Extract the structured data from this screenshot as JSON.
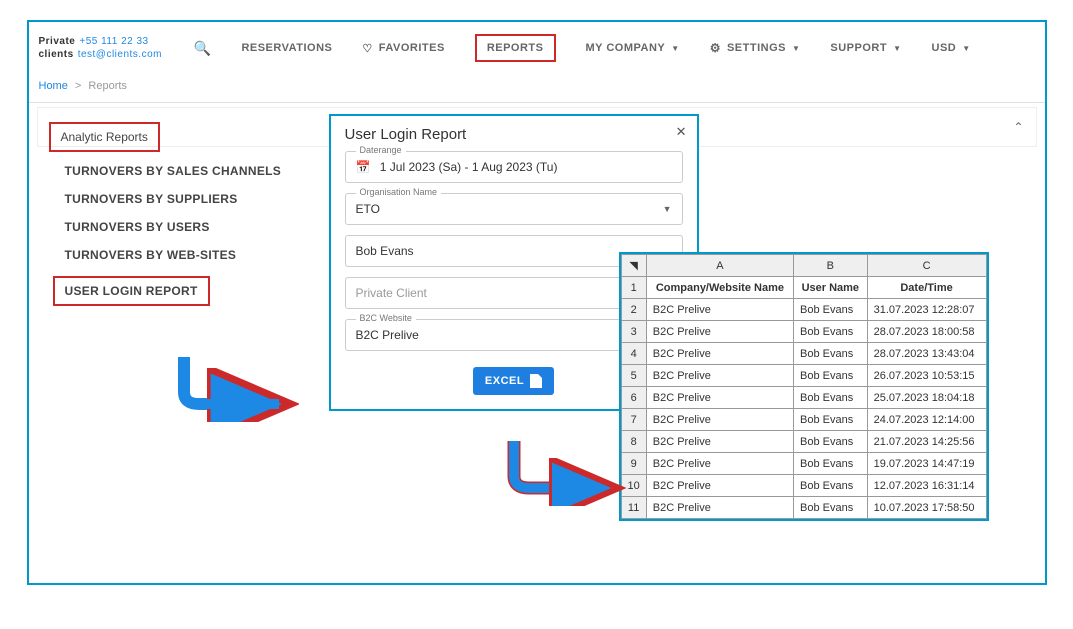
{
  "header": {
    "client_label1": "Private",
    "client_label2": "clients",
    "phone": "+55 111 22 33",
    "email": "test@clients.com",
    "nav": {
      "reservations": "RESERVATIONS",
      "favorites": "FAVORITES",
      "reports": "REPORTS",
      "my_company": "MY COMPANY",
      "settings": "SETTINGS",
      "support": "SUPPORT",
      "currency": "USD"
    }
  },
  "breadcrumb": {
    "home": "Home",
    "current": "Reports"
  },
  "sidebar": {
    "title": "Analytic Reports",
    "items": [
      "TURNOVERS BY SALES CHANNELS",
      "TURNOVERS BY SUPPLIERS",
      "TURNOVERS BY USERS",
      "TURNOVERS BY WEB-SITES",
      "USER LOGIN REPORT"
    ]
  },
  "form": {
    "title": "User Login Report",
    "daterange_label": "Daterange",
    "daterange_value": "1 Jul 2023 (Sa) - 1 Aug 2023 (Tu)",
    "org_label": "Organisation Name",
    "org_value": "ETO",
    "person_value": "Bob Evans",
    "client_placeholder": "Private Client",
    "website_label": "B2C Website",
    "website_value": "B2C Prelive",
    "excel_label": "EXCEL"
  },
  "sheet": {
    "cols": [
      "A",
      "B",
      "C"
    ],
    "headers": [
      "Company/Website Name",
      "User Name",
      "Date/Time"
    ],
    "rows": [
      [
        "B2C Prelive",
        "Bob Evans",
        "31.07.2023 12:28:07"
      ],
      [
        "B2C Prelive",
        "Bob Evans",
        "28.07.2023 18:00:58"
      ],
      [
        "B2C Prelive",
        "Bob Evans",
        "28.07.2023 13:43:04"
      ],
      [
        "B2C Prelive",
        "Bob Evans",
        "26.07.2023 10:53:15"
      ],
      [
        "B2C Prelive",
        "Bob Evans",
        "25.07.2023 18:04:18"
      ],
      [
        "B2C Prelive",
        "Bob Evans",
        "24.07.2023 12:14:00"
      ],
      [
        "B2C Prelive",
        "Bob Evans",
        "21.07.2023 14:25:56"
      ],
      [
        "B2C Prelive",
        "Bob Evans",
        "19.07.2023 14:47:19"
      ],
      [
        "B2C Prelive",
        "Bob Evans",
        "12.07.2023 16:31:14"
      ],
      [
        "B2C Prelive",
        "Bob Evans",
        "10.07.2023 17:58:50"
      ]
    ]
  }
}
